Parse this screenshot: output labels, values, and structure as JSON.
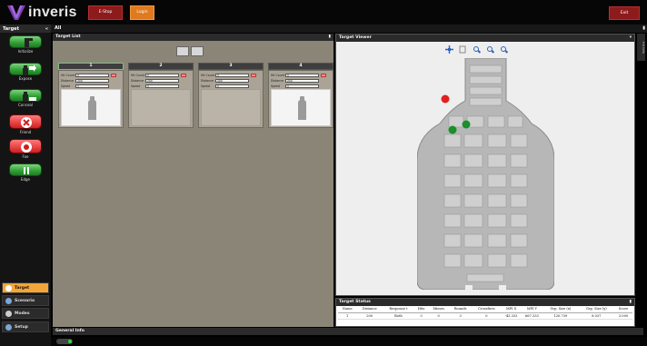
{
  "topbar": {
    "logo_text": "inveris",
    "estop_label": "E-Stop",
    "login_label": "Login",
    "exit_label": "Exit",
    "estop_color": "#8e1b1b",
    "login_color": "#e07a1e"
  },
  "sidebar": {
    "title": "Target",
    "tools": [
      {
        "label": "Initialize",
        "icon": "person-icon"
      },
      {
        "label": "Expose",
        "icon": "person-arrow-icon"
      },
      {
        "label": "Conceal",
        "icon": "person-hide-icon"
      },
      {
        "label": "Friend",
        "icon": "x-circle-icon"
      },
      {
        "label": "Foe",
        "icon": "target-circle-icon"
      },
      {
        "label": "Edge",
        "icon": "edge-bars-icon"
      }
    ],
    "nav": [
      {
        "label": "Target",
        "active": true
      },
      {
        "label": "Scenario",
        "active": false
      },
      {
        "label": "Modes",
        "active": false
      },
      {
        "label": "Setup",
        "active": false
      }
    ]
  },
  "main": {
    "all_label": "All"
  },
  "target_list": {
    "title": "Target List",
    "fields": [
      "Hit Count",
      "Distance",
      "Speed"
    ],
    "cards": [
      {
        "number": "1",
        "hit_count": "0",
        "distance": "200",
        "speed": "0",
        "has_target": true
      },
      {
        "number": "2",
        "hit_count": "0",
        "distance": "200",
        "speed": "0",
        "has_target": false
      },
      {
        "number": "3",
        "hit_count": "0",
        "distance": "200",
        "speed": "0",
        "has_target": false
      },
      {
        "number": "4",
        "hit_count": "0",
        "distance": "200",
        "speed": "0",
        "has_target": true
      }
    ]
  },
  "target_viewer": {
    "title": "Target Viewer",
    "side_tab": "Hit Info",
    "hits": [
      {
        "color": "#e02020"
      },
      {
        "color": "#1a8f2a"
      },
      {
        "color": "#1a8f2a"
      }
    ]
  },
  "target_status": {
    "title": "Target Status",
    "columns": [
      "Name",
      "Distance",
      "Response t",
      "Hits",
      "Misses",
      "Rounds",
      "Crossfires",
      "MPI X",
      "MPI Y",
      "Grp. Size (x)",
      "Grp. Size (y)",
      "Score"
    ],
    "rows": [
      [
        "1",
        "200",
        "Both",
        "3",
        "0",
        "3",
        "0",
        "-43.333",
        "667.333",
        "120.739",
        "8.037",
        "3.000"
      ]
    ]
  },
  "general_info": {
    "title": "General Info"
  }
}
